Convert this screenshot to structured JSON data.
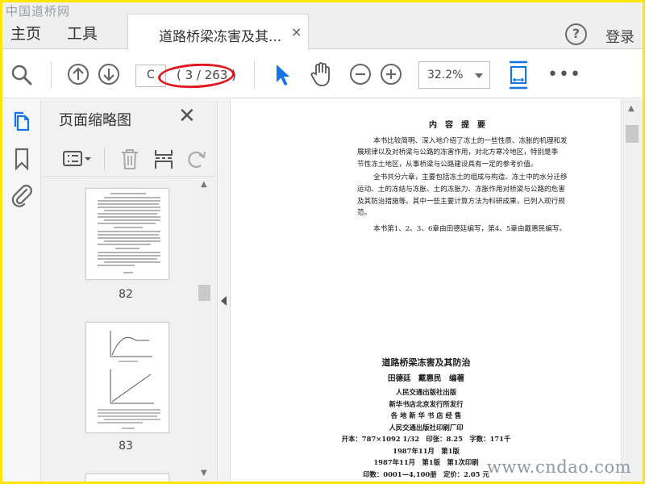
{
  "watermark": {
    "top": "中国道桥网",
    "bottom": "www.cndao.com"
  },
  "tabbar": {
    "home": "主页",
    "tools": "工具",
    "doc_tab_title": "道路桥梁冻害及其...",
    "close": "×",
    "help": "?",
    "login": "登录"
  },
  "toolbar": {
    "page_input": "C",
    "page_count": "( 3 / 263 )",
    "zoom": "32.2%",
    "more": "•••"
  },
  "thumb_panel": {
    "title": "页面缩略图",
    "pages": [
      {
        "label": "82"
      },
      {
        "label": "83"
      }
    ]
  },
  "doc": {
    "summary_title": "内　容　提　要",
    "summary_p1_lines": [
      "本书比较简明、深入地介绍了冻土的一些性质、冻胀的机理和发",
      "展规律以及对桥梁与公路的冻害作用，对北方寒冷地区，特别是季",
      "节性冻土地区，从事桥梁与公路建设具有一定的参考价值。"
    ],
    "summary_p2_lines": [
      "全书共分六章，主要包括冻土的组成与构造、冻土中的水分迁移",
      "运动、土的冻结与冻胀、土的冻胀力、冻胀作用对桥梁与公路的危害",
      "及其防治措施等。其中一些主要计算方法为科研成果，已列入现行规",
      "范。"
    ],
    "summary_p3": "本书第1、2、3、6章由田德廷编写，第4、5章由戴惠民编写。",
    "book_title": "道路桥梁冻害及其防治",
    "authors": "田德廷　戴惠民　编著",
    "pub_lines": [
      "人民交通出版社出版",
      "新华书店北京发行所发行",
      "各 地 新 华 书 店 经 售",
      "人民交通出版社印刷厂印",
      "开本：787×1092 1/32　印张：8.25　字数：171千",
      "1987年11月　第1版",
      "1987年11月　第1版　第1次印刷",
      "印数：0001—4,100册　定价：2.05 元"
    ]
  },
  "colors": {
    "accent_blue": "#1473e6",
    "annotation_red": "#e0181f",
    "frame_yellow": "#ffe600"
  }
}
